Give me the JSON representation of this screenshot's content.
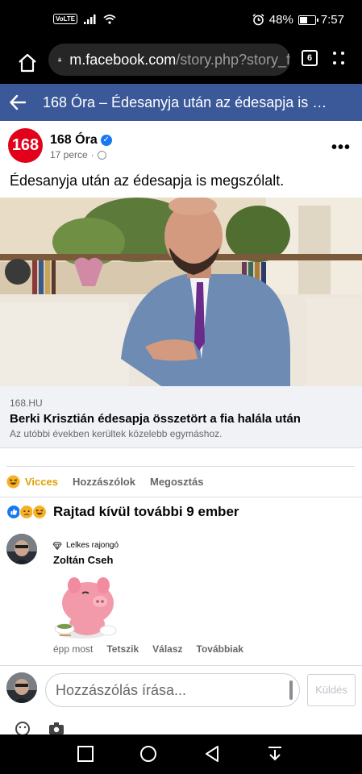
{
  "status_bar": {
    "volte": "VoLTE",
    "battery": "48%",
    "battery_level": 0.48,
    "time": "7:57"
  },
  "browser": {
    "url_host": "m.facebook.com",
    "url_path": "/story.php?story_f",
    "tab_count": "6"
  },
  "header": {
    "title": "168 Óra – Édesanyja után az édesapja is …",
    "bar_color": "#3b5998"
  },
  "post": {
    "page_avatar_text": "168",
    "page_name": "168 Óra",
    "time": "17 perce",
    "dot": "·",
    "text": "Édesanyja után az édesapja is megszólalt.",
    "link": {
      "domain": "168.HU",
      "title": "Berki Krisztián édesapja összetört a fia halála után",
      "description": "Az utóbbi években kerültek közelebb egymáshoz."
    }
  },
  "actions": {
    "reaction": "Vicces",
    "comment": "Hozzászólok",
    "share": "Megosztás"
  },
  "reactions_summary": {
    "icons": [
      "like-icon",
      "sad-icon",
      "haha-icon"
    ],
    "text": "Rajtad kívül további 9 ember"
  },
  "comment": {
    "badge": "Lelkes rajongó",
    "author": "Zoltán Cseh",
    "time": "épp most",
    "like": "Tetszik",
    "reply": "Válasz",
    "more": "Továbbiak"
  },
  "composer": {
    "placeholder": "Hozzászólás írása...",
    "send": "Küldés"
  },
  "colors": {
    "brand_red": "#e2001a",
    "fb_blue": "#1877f2",
    "haha_yellow": "#f7b125"
  }
}
